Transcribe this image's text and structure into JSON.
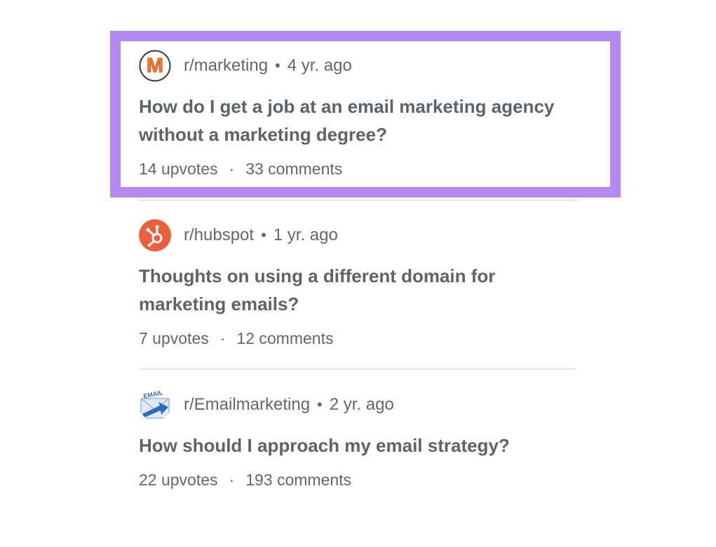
{
  "highlight_color": "#b48af2",
  "posts": [
    {
      "subreddit": "r/marketing",
      "separator": "•",
      "age": "4 yr. ago",
      "title": "How do I get a job at an email marketing agency without a marketing degree?",
      "upvotes": "14 upvotes",
      "stats_separator": "·",
      "comments": "33 comments",
      "icon": "marketing-m-logo-icon",
      "icon_letter": "M"
    },
    {
      "subreddit": "r/hubspot",
      "separator": "•",
      "age": "1 yr. ago",
      "title": "Thoughts on using a different domain for marketing emails?",
      "upvotes": "7 upvotes",
      "stats_separator": "·",
      "comments": "12 comments",
      "icon": "hubspot-sprocket-icon",
      "icon_color": "#ef5e3a"
    },
    {
      "subreddit": "r/Emailmarketing",
      "separator": "•",
      "age": "2 yr. ago",
      "title": "How should I approach my email strategy?",
      "upvotes": "22 upvotes",
      "stats_separator": "·",
      "comments": "193 comments",
      "icon": "email-envelope-icon",
      "icon_label": "EMAIL"
    }
  ]
}
